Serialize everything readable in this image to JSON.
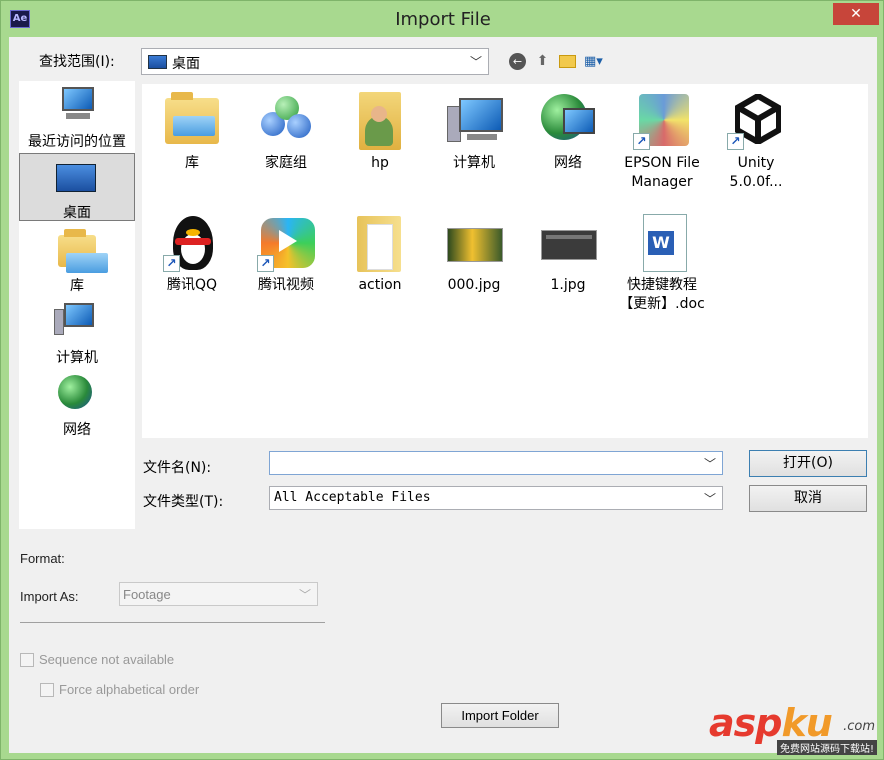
{
  "window": {
    "title": "Import File",
    "app_icon": "Ae",
    "close_glyph": "✕"
  },
  "lookin": {
    "label": "查找范围(I):",
    "value": "桌面"
  },
  "places": [
    {
      "label": "最近访问的位置",
      "icon": "recent-places-icon"
    },
    {
      "label": "桌面",
      "icon": "desktop-icon",
      "selected": true
    },
    {
      "label": "库",
      "icon": "libraries-icon"
    },
    {
      "label": "计算机",
      "icon": "computer-icon"
    },
    {
      "label": "网络",
      "icon": "network-icon"
    }
  ],
  "files": [
    {
      "label": "库",
      "icon": "libraries-icon"
    },
    {
      "label": "家庭组",
      "icon": "homegroup-icon"
    },
    {
      "label": "hp",
      "icon": "user-folder-icon"
    },
    {
      "label": "计算机",
      "icon": "computer-icon"
    },
    {
      "label": "网络",
      "icon": "network-icon"
    },
    {
      "label": "EPSON File Manager",
      "icon": "epson-shortcut-icon"
    },
    {
      "label": "Unity 5.0.0f...",
      "icon": "unity-shortcut-icon"
    },
    {
      "label": "腾讯QQ",
      "icon": "qq-shortcut-icon"
    },
    {
      "label": "腾讯视频",
      "icon": "tencent-video-shortcut-icon"
    },
    {
      "label": "action",
      "icon": "folder-icon"
    },
    {
      "label": "000.jpg",
      "icon": "jpg-thumbnail-icon"
    },
    {
      "label": "1.jpg",
      "icon": "jpg-thumbnail-icon"
    },
    {
      "label": "快捷键教程【更新】.doc",
      "icon": "word-doc-icon"
    }
  ],
  "filename": {
    "label": "文件名(N):",
    "value": ""
  },
  "filetype": {
    "label": "文件类型(T):",
    "value": "All Acceptable Files"
  },
  "buttons": {
    "open": "打开(O)",
    "cancel": "取消",
    "import_folder": "Import Folder"
  },
  "options": {
    "format_label": "Format:",
    "import_as_label": "Import As:",
    "import_as_value": "Footage",
    "sequence_label": "Sequence not available",
    "alphabetical_label": "Force alphabetical order"
  },
  "watermark": {
    "asp": "asp",
    "ku": "ku",
    "com": ".com",
    "sub": "免费网站源码下载站!"
  }
}
